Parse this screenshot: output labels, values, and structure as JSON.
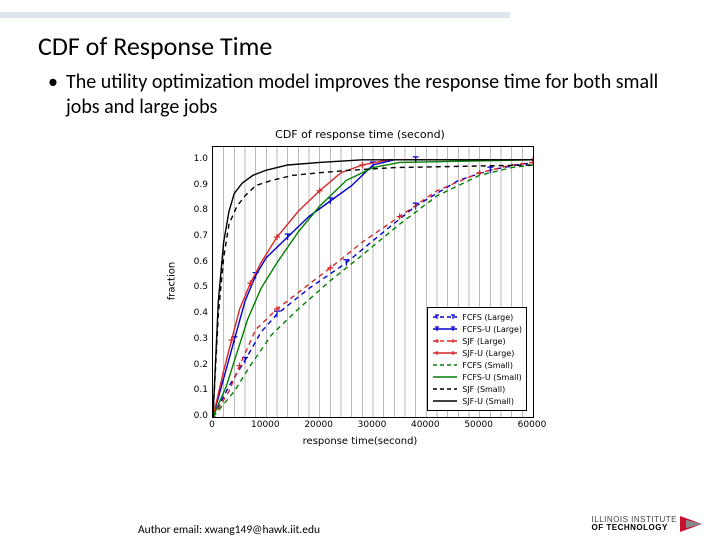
{
  "header": {
    "title": "CDF of Response Time"
  },
  "bullet": {
    "dot": "•",
    "text": "The utility optimization model improves the response time for both small jobs and large jobs"
  },
  "footer": {
    "text": "Author email: xwang149@hawk.iit.edu"
  },
  "logo": {
    "line1": "ILLINOIS INSTITUTE",
    "line2": "OF TECHNOLOGY"
  },
  "chart_data": {
    "type": "line",
    "title": "CDF of response time (second)",
    "xlabel": "response time(second)",
    "ylabel": "fraction",
    "xlim": [
      0,
      60000
    ],
    "ylim": [
      0.0,
      1.05
    ],
    "xticks": [
      0,
      10000,
      20000,
      30000,
      40000,
      50000,
      60000
    ],
    "yticks": [
      0.0,
      0.1,
      0.2,
      0.3,
      0.4,
      0.5,
      0.6,
      0.7,
      0.8,
      0.9,
      1.0
    ],
    "vgrid_minor": [
      2000,
      4000,
      6000,
      8000,
      10000,
      12000,
      14000,
      16000,
      18000,
      20000,
      22000,
      24000,
      26000,
      28000,
      30000,
      32000,
      34000,
      36000,
      38000,
      40000,
      42000,
      44000,
      46000,
      48000,
      50000,
      52000,
      54000,
      56000,
      58000
    ],
    "series": [
      {
        "name": "FCFS (Large)",
        "color": "#0000cd",
        "dash": true,
        "marker": "T",
        "x": [
          0,
          3000,
          6000,
          9000,
          12000,
          18000,
          25000,
          32000,
          38000,
          46000,
          52000,
          57000,
          60000
        ],
        "y": [
          0.0,
          0.12,
          0.22,
          0.33,
          0.4,
          0.5,
          0.6,
          0.72,
          0.82,
          0.92,
          0.96,
          0.98,
          0.99
        ]
      },
      {
        "name": "FCFS-U (Large)",
        "color": "#0000cd",
        "dash": false,
        "marker": "T",
        "x": [
          0,
          2000,
          4000,
          6000,
          8000,
          10000,
          14000,
          18000,
          22000,
          26000,
          30000,
          34000,
          38000,
          60000
        ],
        "y": [
          0.0,
          0.15,
          0.3,
          0.45,
          0.55,
          0.62,
          0.7,
          0.78,
          0.84,
          0.9,
          0.98,
          1.0,
          1.0,
          1.0
        ]
      },
      {
        "name": "SJF (Large)",
        "color": "#d62728",
        "dash": true,
        "marker": "+",
        "x": [
          0,
          3000,
          5000,
          8000,
          12000,
          17000,
          22000,
          28000,
          35000,
          42000,
          50000,
          56000,
          60000
        ],
        "y": [
          0.0,
          0.1,
          0.2,
          0.34,
          0.42,
          0.5,
          0.58,
          0.68,
          0.78,
          0.88,
          0.95,
          0.98,
          0.99
        ]
      },
      {
        "name": "SJF-U (Large)",
        "color": "#d62728",
        "dash": false,
        "marker": "+",
        "x": [
          0,
          2000,
          3500,
          5000,
          7000,
          9000,
          12000,
          16000,
          20000,
          24000,
          28000,
          33000,
          60000
        ],
        "y": [
          0.0,
          0.18,
          0.3,
          0.42,
          0.52,
          0.6,
          0.7,
          0.8,
          0.88,
          0.95,
          0.98,
          1.0,
          1.0
        ]
      },
      {
        "name": "FCFS (Small)",
        "color": "#008000",
        "dash": true,
        "marker": "",
        "x": [
          0,
          4000,
          7000,
          11000,
          16000,
          22000,
          28000,
          35000,
          42000,
          50000,
          56000,
          60000
        ],
        "y": [
          0.0,
          0.1,
          0.2,
          0.32,
          0.42,
          0.53,
          0.63,
          0.75,
          0.86,
          0.94,
          0.97,
          0.98
        ]
      },
      {
        "name": "FCFS-U (Small)",
        "color": "#008000",
        "dash": false,
        "marker": "",
        "x": [
          0,
          2500,
          4500,
          6500,
          9000,
          12000,
          16000,
          20000,
          25000,
          30000,
          35000,
          60000
        ],
        "y": [
          0.0,
          0.12,
          0.25,
          0.38,
          0.5,
          0.6,
          0.72,
          0.82,
          0.92,
          0.97,
          0.99,
          1.0
        ]
      },
      {
        "name": "SJF (Small)",
        "color": "#000000",
        "dash": true,
        "marker": "",
        "x": [
          0,
          1000,
          2000,
          3000,
          4500,
          6000,
          8000,
          11000,
          15000,
          20000,
          26000,
          34000,
          60000
        ],
        "y": [
          0.0,
          0.4,
          0.62,
          0.75,
          0.82,
          0.86,
          0.9,
          0.92,
          0.94,
          0.95,
          0.96,
          0.97,
          0.98
        ]
      },
      {
        "name": "SJF-U (Small)",
        "color": "#000000",
        "dash": false,
        "marker": "",
        "x": [
          0,
          1000,
          2000,
          3000,
          4000,
          5500,
          7500,
          10000,
          14000,
          20000,
          28000,
          60000
        ],
        "y": [
          0.0,
          0.45,
          0.68,
          0.8,
          0.87,
          0.91,
          0.94,
          0.96,
          0.98,
          0.99,
          1.0,
          1.0
        ]
      }
    ]
  }
}
